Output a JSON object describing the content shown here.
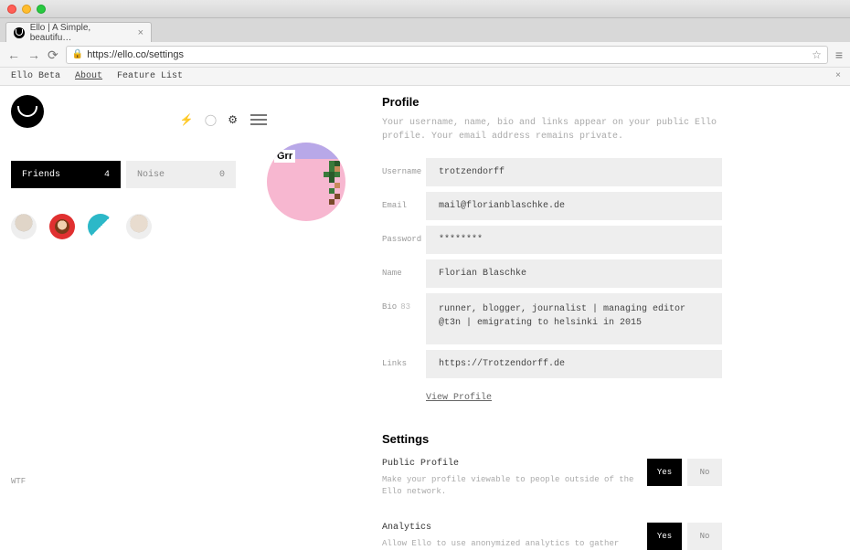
{
  "browser": {
    "tab_title": "Ello | A Simple, beautifu…",
    "url": "https://ello.co/settings"
  },
  "submenu": {
    "items": [
      "Ello Beta",
      "About",
      "Feature List"
    ]
  },
  "sidebar": {
    "tabs": [
      {
        "label": "Friends",
        "count": "4"
      },
      {
        "label": "Noise",
        "count": "0"
      }
    ]
  },
  "avatar": {
    "grr": "Grr"
  },
  "profile": {
    "title": "Profile",
    "subtitle": "Your username, name, bio and links appear on your public Ello profile. Your email address remains private.",
    "fields": {
      "username": {
        "label": "Username",
        "value": "trotzendorff"
      },
      "email": {
        "label": "Email",
        "value": "mail@florianblaschke.de"
      },
      "password": {
        "label": "Password",
        "value": "********"
      },
      "name": {
        "label": "Name",
        "value": "Florian Blaschke"
      },
      "bio": {
        "label": "Bio",
        "count": "83",
        "value": "runner, blogger, journalist | managing editor @t3n | emigrating to helsinki in 2015"
      },
      "links": {
        "label": "Links",
        "value": "https://Trotzendorff.de"
      }
    },
    "view_profile": "View Profile"
  },
  "settings": {
    "title": "Settings",
    "rows": [
      {
        "name": "Public Profile",
        "desc": "Make your profile viewable to people outside of the Ello network.",
        "yes": "Yes",
        "no": "No"
      },
      {
        "name": "Analytics",
        "desc": "Allow Ello to use anonymized analytics to gather",
        "yes": "Yes",
        "no": "No"
      }
    ]
  },
  "footer": {
    "wtf": "WTF"
  }
}
